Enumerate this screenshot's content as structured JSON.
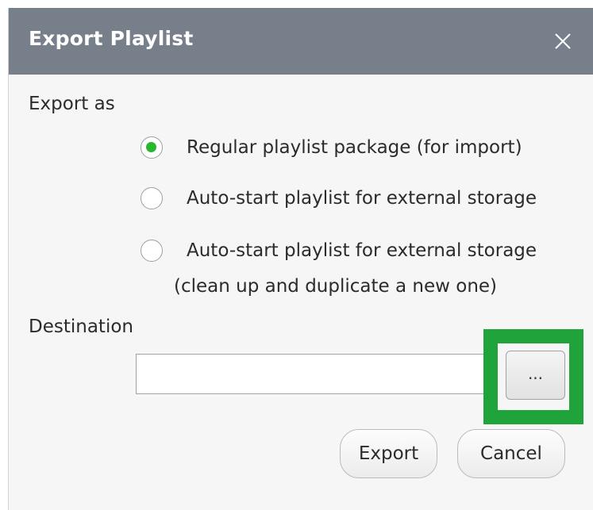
{
  "dialog": {
    "title": "Export Playlist",
    "close_icon": "close-icon"
  },
  "export_as": {
    "label": "Export as",
    "options": [
      {
        "label": "Regular playlist package (for import)",
        "selected": true
      },
      {
        "label": "Auto-start playlist for external storage",
        "selected": false
      },
      {
        "label": "Auto-start playlist for external storage",
        "sublabel": "(clean up and duplicate a new one)",
        "selected": false
      }
    ]
  },
  "destination": {
    "label": "Destination",
    "value": "",
    "browse_label": "..."
  },
  "buttons": {
    "export_label": "Export",
    "cancel_label": "Cancel"
  },
  "colors": {
    "titlebar": "#767f8a",
    "radio_selected": "#27b82f",
    "highlight": "#1fa33a"
  }
}
